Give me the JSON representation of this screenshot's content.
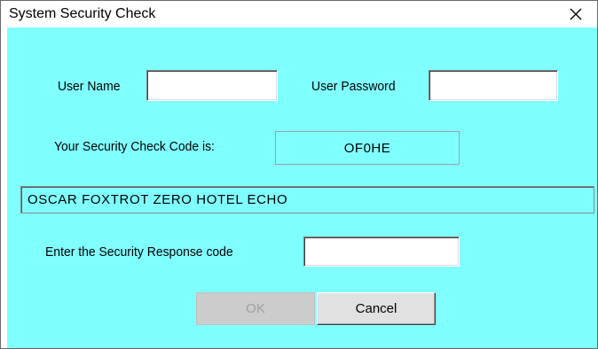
{
  "window": {
    "title": "System Security Check",
    "close_glyph": "✕"
  },
  "form": {
    "user_name_label": "User Name",
    "user_name_value": "",
    "user_password_label": "User Password",
    "user_password_value": "",
    "security_code_label": "Your Security Check Code is:",
    "security_code_value": "OF0HE",
    "phonetic_value": "OSCAR FOXTROT ZERO HOTEL ECHO",
    "response_label": "Enter the Security Response code",
    "response_value": ""
  },
  "buttons": {
    "ok_label": "OK",
    "ok_enabled": false,
    "cancel_label": "Cancel"
  },
  "colors": {
    "client_background": "#80ffff",
    "titlebar_background": "#ffffff",
    "disabled_text": "#a0a0a0"
  },
  "icons": {
    "close": "close-icon"
  }
}
